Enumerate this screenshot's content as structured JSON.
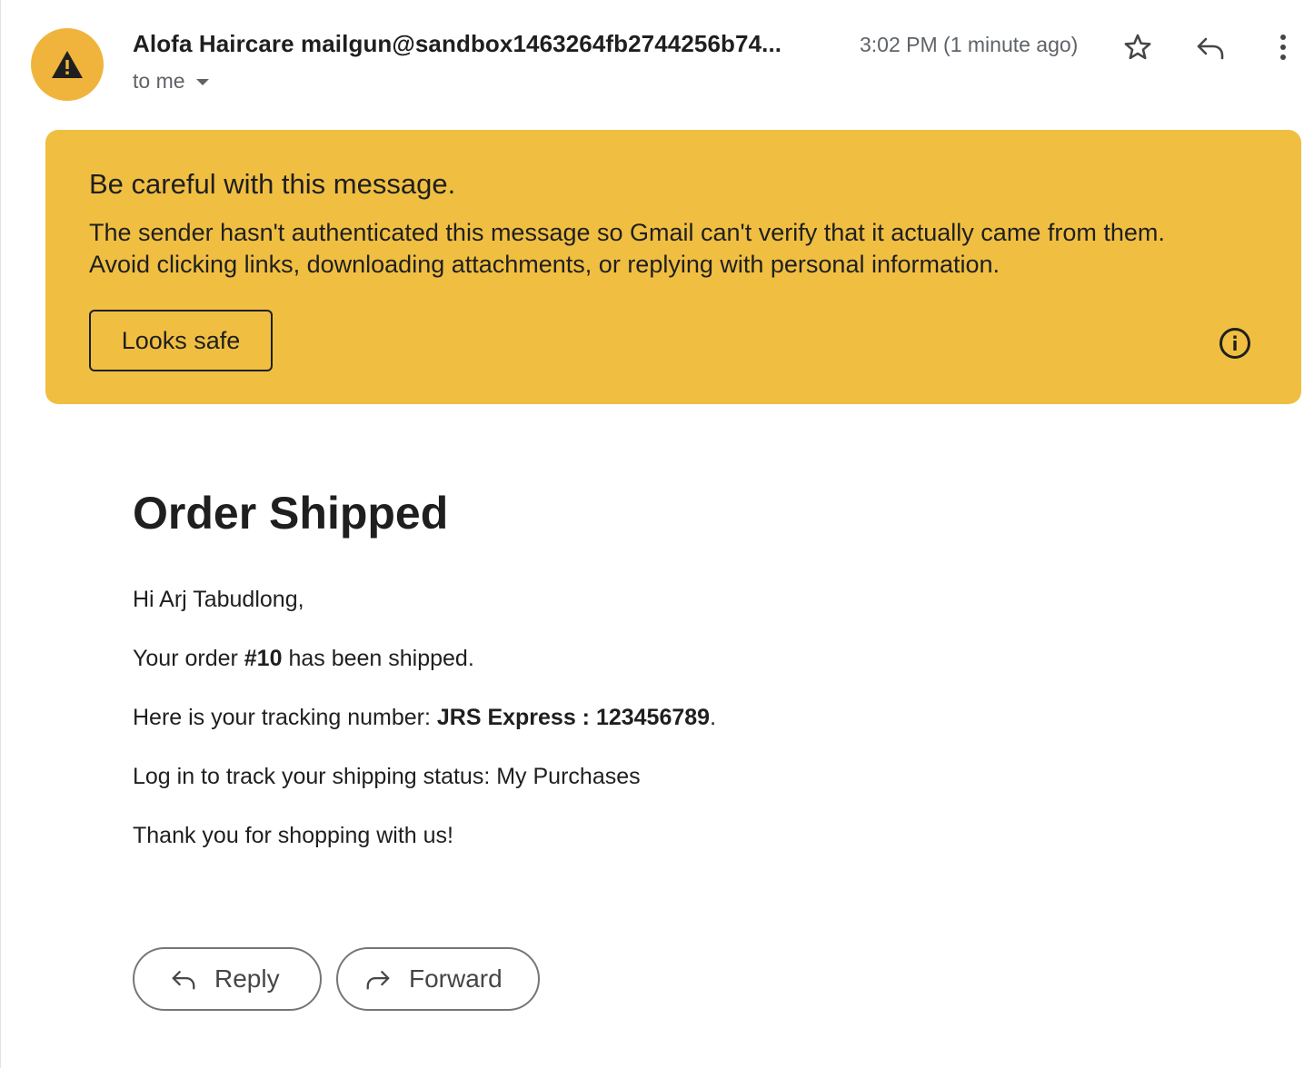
{
  "header": {
    "sender_name": "Alofa Haircare",
    "sender_email": "mailgun@sandbox1463264fb2744256b74...",
    "timestamp": "3:02 PM (1 minute ago)",
    "recipient_label": "to me"
  },
  "warning": {
    "title": "Be careful with this message.",
    "body_line_1": "The sender hasn't authenticated this message so Gmail can't verify that it actually came from them.",
    "body_line_2": "Avoid clicking links, downloading attachments, or replying with personal information.",
    "looks_safe_label": "Looks safe",
    "banner_color": "#f0bf42",
    "avatar_color": "#f0b43c"
  },
  "email": {
    "title": "Order Shipped",
    "greeting": "Hi Arj Tabudlong,",
    "order_prefix": "Your order ",
    "order_number": "#10",
    "order_suffix": " has been shipped.",
    "tracking_prefix": "Here is your tracking number: ",
    "tracking_value": "JRS Express : 123456789",
    "tracking_suffix": ".",
    "login_prefix": "Log in to track your shipping status: ",
    "login_link": "My Purchases",
    "closing": "Thank you for shopping with us!"
  },
  "actions": {
    "reply_label": "Reply",
    "forward_label": "Forward"
  },
  "icons": {
    "avatar": "warning-triangle-icon",
    "star": "star-icon",
    "reply": "reply-icon",
    "more": "more-vert-icon",
    "dropdown": "caret-down-icon",
    "info": "info-icon",
    "forward": "forward-icon"
  }
}
